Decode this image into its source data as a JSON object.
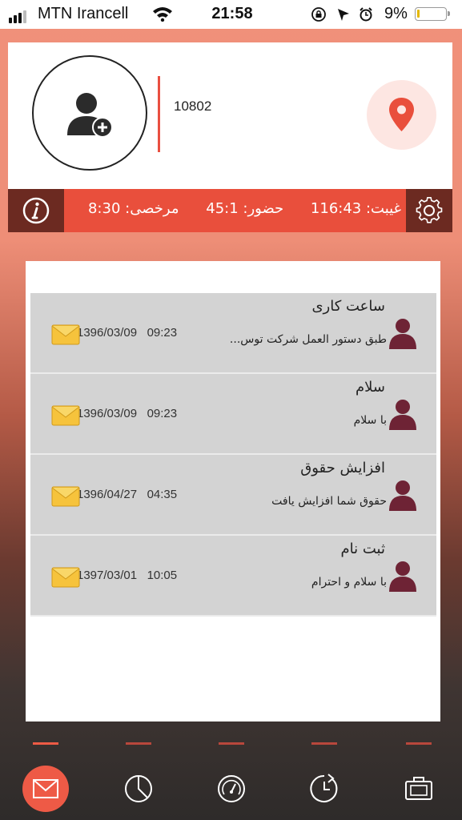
{
  "status_bar": {
    "carrier": "MTN Irancell",
    "time": "21:58",
    "battery_percent": "9%",
    "battery_level": 0.09
  },
  "profile": {
    "user_id": "10802",
    "avatar_icon": "add-user-icon",
    "location_icon": "location-pin-icon"
  },
  "stats": {
    "absence": "غیبت: 116:43",
    "presence": "حضور: 45:1",
    "leave": "مرخصی: 8:30"
  },
  "messages": [
    {
      "title": "ساعت کاری",
      "preview": "طبق دستور العمل شرکت توس...",
      "datetime": "1396/03/09   09:23"
    },
    {
      "title": "سلام",
      "preview": "با سلام",
      "datetime": "1396/03/09   09:23"
    },
    {
      "title": "افزایش حقوق",
      "preview": "حقوق شما افزایش یافت",
      "datetime": "1396/04/27   04:35"
    },
    {
      "title": "ثبت نام",
      "preview": "با سلام و احترام",
      "datetime": "1397/03/01   10:05"
    }
  ],
  "tabs": [
    {
      "icon": "mail-icon",
      "active": true
    },
    {
      "icon": "pie-chart-icon",
      "active": false
    },
    {
      "icon": "speedometer-icon",
      "active": false
    },
    {
      "icon": "history-icon",
      "active": false
    },
    {
      "icon": "briefcase-icon",
      "active": false
    }
  ],
  "colors": {
    "accent": "#e94f3c",
    "dark_accent": "#6c2a21",
    "user_icon": "#6e2335"
  }
}
